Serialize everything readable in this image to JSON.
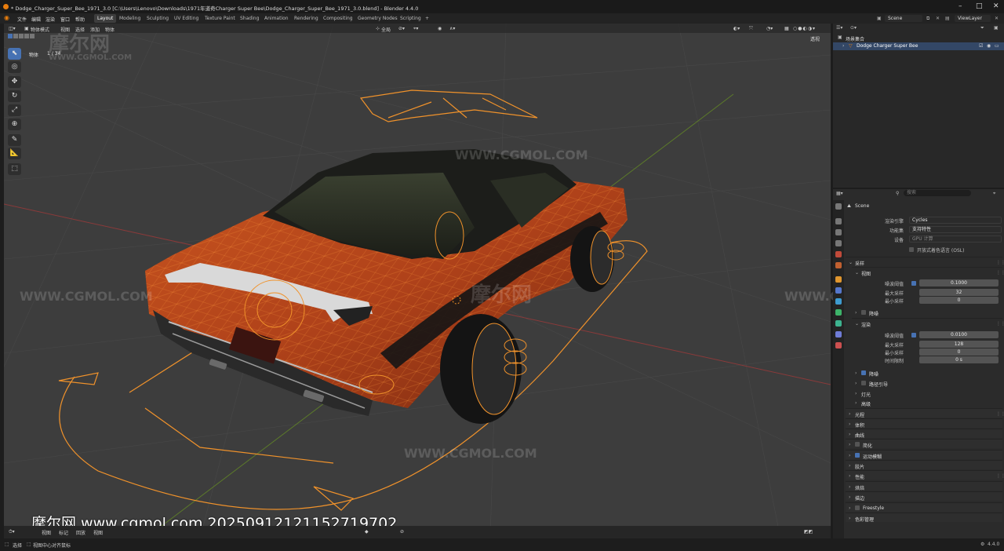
{
  "window": {
    "title": "* Dodge_Charger_Super_Bee_1971_3.0 [C:\\Users\\Lenovo\\Downloads\\1971年道奇Charger Super Bee\\Dodge_Charger_Super_Bee_1971_3.0.blend] - Blender 4.4.0"
  },
  "menu": [
    "文件",
    "编辑",
    "渲染",
    "窗口",
    "帮助"
  ],
  "workspaces": [
    "Layout",
    "Modeling",
    "Sculpting",
    "UV Editing",
    "Texture Paint",
    "Shading",
    "Animation",
    "Rendering",
    "Compositing",
    "Geometry Nodes",
    "Scripting"
  ],
  "workspace_add": "+",
  "top_right": {
    "scene": "Scene",
    "view_layer": "ViewLayer"
  },
  "viewport_header": {
    "mode": "物体模式",
    "menus": [
      "视图",
      "选择",
      "添加",
      "物体"
    ],
    "transform_orientation": "全局",
    "view_label": "透视"
  },
  "viewport_info": {
    "label": "物体",
    "count": "1 / 34"
  },
  "outliner": {
    "collection": "场景集合",
    "object": "Dodge Charger Super Bee"
  },
  "properties": {
    "search_placeholder": "搜索",
    "scene_name": "Scene",
    "render_engine_label": "渲染引擎",
    "render_engine": "Cycles",
    "feature_set_label": "功能集",
    "feature_set": "支持特性",
    "device_label": "设备",
    "device": "GPU 计算",
    "osl_label": "开放式着色语言 (OSL)",
    "sampling_header": "采样",
    "viewport_header": "视图",
    "vp_noise_threshold_label": "噪波阈值",
    "vp_noise_threshold": "0.1000",
    "vp_max_samples_label": "最大采样",
    "vp_max_samples": "32",
    "vp_min_samples_label": "最小采样",
    "vp_min_samples": "0",
    "denoise_label": "降噪",
    "render_header": "渲染",
    "r_noise_threshold_label": "噪波阈值",
    "r_noise_threshold": "0.0100",
    "r_max_samples_label": "最大采样",
    "r_max_samples": "128",
    "r_min_samples_label": "最小采样",
    "r_min_samples": "0",
    "time_limit_label": "时间限制",
    "time_limit": "0 s",
    "sub_sections": [
      "降噪",
      "路径引导",
      "灯光",
      "高级"
    ],
    "sections": [
      "光程",
      "体积",
      "曲线",
      "简化",
      "运动模糊",
      "胶片",
      "性能",
      "烘焙",
      "描边",
      "Freestyle",
      "色彩管理"
    ]
  },
  "statusbar": {
    "select_label": "选择",
    "rotate_label": "旋转视图",
    "context_label": "视图中心对齐鼠标",
    "version": "4.4.0"
  },
  "bottom_toolbar": {
    "menus": [
      "视图",
      "标记",
      "回放",
      "视图"
    ]
  },
  "watermark": {
    "logo": "摩尔网",
    "url": "WWW.CGMOL.COM",
    "caption": "摩尔网 www.cgmol.com 20250912121152719702"
  },
  "colors": {
    "accent": "#4772b3",
    "selection_orange": "#f0922b",
    "car_paint": "#b3451a"
  }
}
